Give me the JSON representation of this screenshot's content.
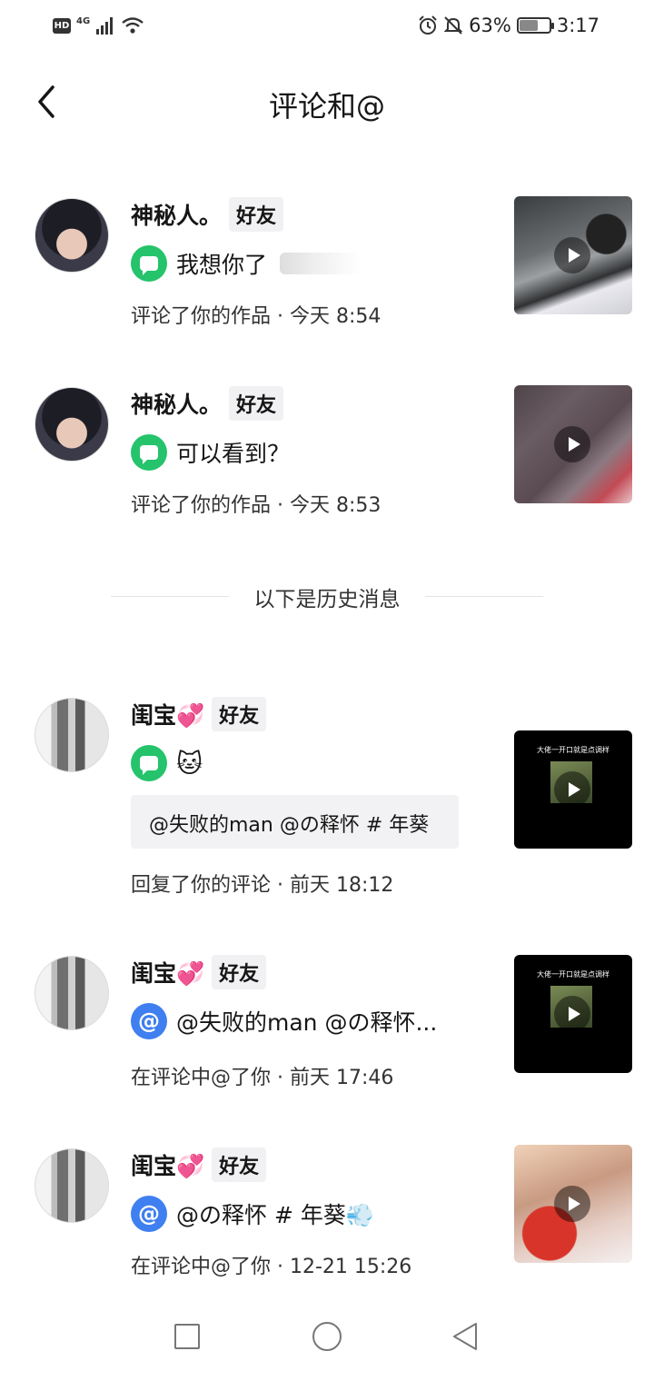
{
  "status_bar": {
    "hd": "HD",
    "network": "4G",
    "battery_percent": "63%",
    "battery_level": 0.63,
    "time": "3:17"
  },
  "header": {
    "title": "评论和@"
  },
  "divider": {
    "label": "以下是历史消息"
  },
  "notifications": [
    {
      "user": "神秘人。",
      "badge": "好友",
      "type": "comment",
      "text": "我想你了",
      "meta": "评论了你的作品 · 今天 8:54"
    },
    {
      "user": "神秘人。",
      "badge": "好友",
      "type": "comment",
      "text": "可以看到？",
      "meta": "评论了你的作品 · 今天 8:53"
    },
    {
      "user": "闺宝💞",
      "badge": "好友",
      "type": "comment",
      "text": "🐱",
      "quote": "@失败的man @の释怀 # 年葵",
      "meta": "回复了你的评论 · 前天 18:12",
      "thumb_caption": "大佬一开口就是点调样"
    },
    {
      "user": "闺宝💞",
      "badge": "好友",
      "type": "mention",
      "text": "@失败的man @の释怀...",
      "meta": "在评论中@了你 · 前天 17:46",
      "thumb_caption": "大佬一开口就是点调样"
    },
    {
      "user": "闺宝💞",
      "badge": "好友",
      "type": "mention",
      "text": "@の释怀 # 年葵💨",
      "meta": "在评论中@了你 · 12-21 15:26"
    }
  ],
  "icons": {
    "back": "chevron-left-icon",
    "comment": "comment-bubble-icon",
    "mention": "at-icon",
    "play": "play-icon",
    "alarm": "alarm-icon",
    "mute": "bell-off-icon",
    "wifi": "wifi-icon",
    "signal": "signal-icon"
  },
  "colors": {
    "comment_icon": "#25c36b",
    "mention_icon": "#3f7ff0",
    "badge_bg": "#f1f1f3"
  }
}
